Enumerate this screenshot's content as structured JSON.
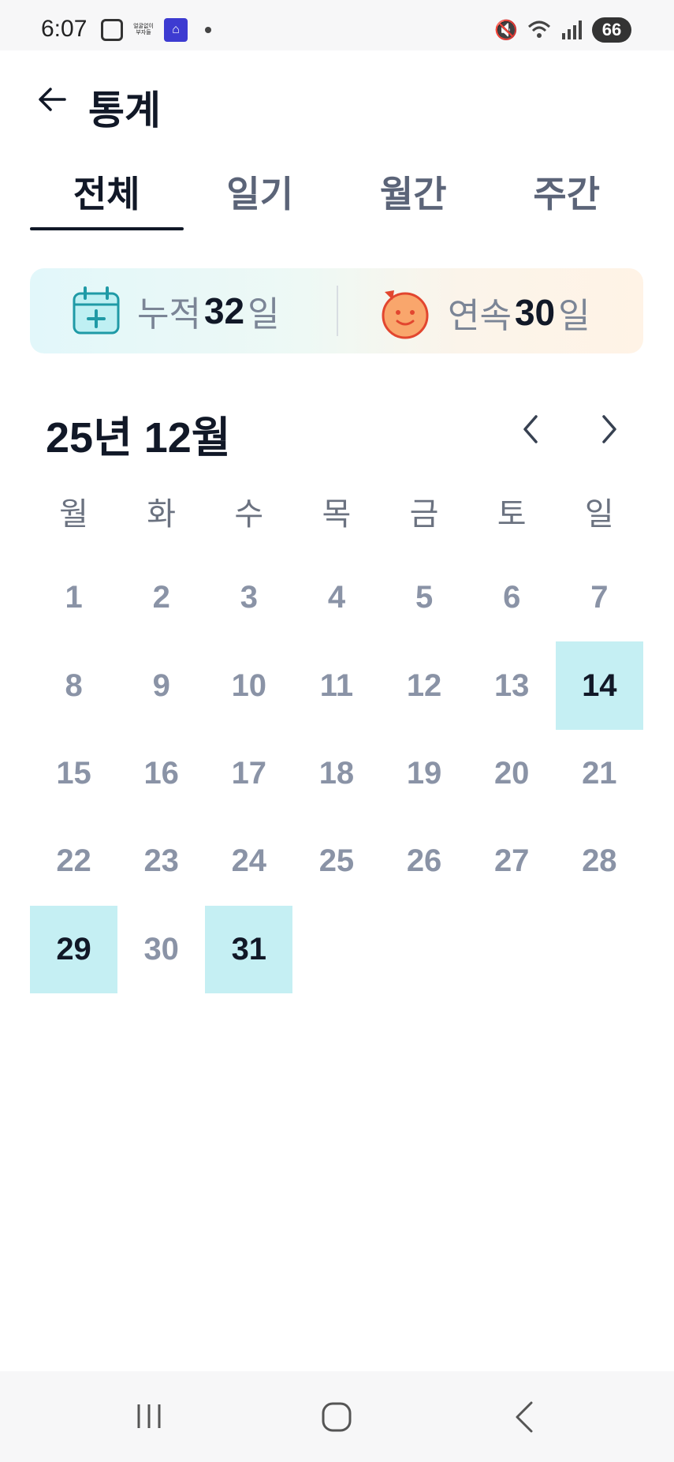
{
  "status_bar": {
    "time": "6:07",
    "notif_icon_text": "얼굴없이 부자들",
    "battery": "66",
    "icons": [
      "screenshot-icon",
      "app-notification-icon",
      "home-app-icon",
      "mute-icon",
      "wifi-icon",
      "signal-icon",
      "battery-icon"
    ]
  },
  "header": {
    "title": "통계",
    "back_icon": "arrow-left-icon"
  },
  "tabs": [
    {
      "label": "전체",
      "active": true
    },
    {
      "label": "일기",
      "active": false
    },
    {
      "label": "월간",
      "active": false
    },
    {
      "label": "주간",
      "active": false
    }
  ],
  "summary": {
    "cumulative": {
      "label": "누적",
      "value": "32",
      "unit": "일",
      "icon": "calendar-plus-icon"
    },
    "streak": {
      "label": "연속",
      "value": "30",
      "unit": "일",
      "icon": "smiley-face-icon"
    }
  },
  "calendar": {
    "month_label": "25년 12월",
    "weekdays": [
      "월",
      "화",
      "수",
      "목",
      "금",
      "토",
      "일"
    ],
    "days": [
      "1",
      "2",
      "3",
      "4",
      "5",
      "6",
      "7",
      "8",
      "9",
      "10",
      "11",
      "12",
      "13",
      "14",
      "15",
      "16",
      "17",
      "18",
      "19",
      "20",
      "21",
      "22",
      "23",
      "24",
      "25",
      "26",
      "27",
      "28",
      "29",
      "30",
      "31"
    ],
    "marked_days": [
      "14",
      "29",
      "31"
    ],
    "mark_color": "#c5eff3"
  },
  "colors": {
    "accent_dark": "#111827",
    "muted_text": "#8a93a6",
    "marked_bg": "#c5eff3"
  }
}
